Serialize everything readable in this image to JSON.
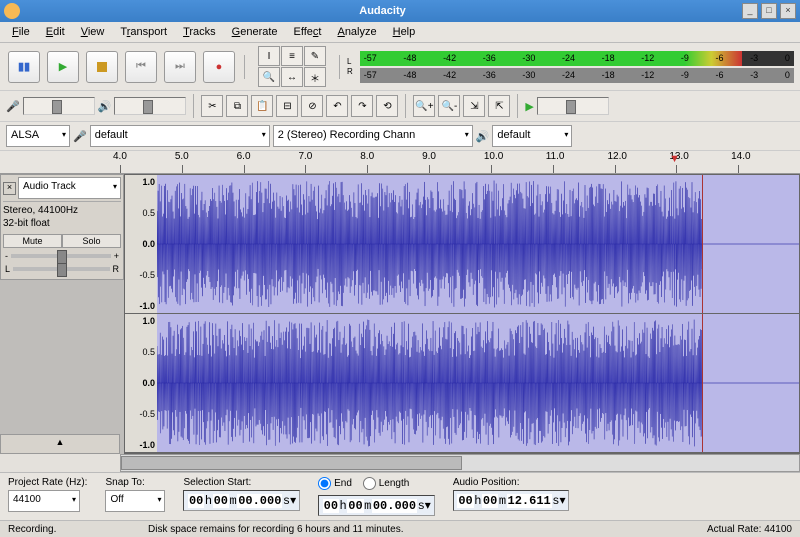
{
  "window": {
    "title": "Audacity"
  },
  "menu": {
    "items": [
      "File",
      "Edit",
      "View",
      "Transport",
      "Tracks",
      "Generate",
      "Effect",
      "Analyze",
      "Help"
    ]
  },
  "meters": {
    "ticks": [
      "-57",
      "-48",
      "-42",
      "-36",
      "-30",
      "-24",
      "-18",
      "-12",
      "-9",
      "-6",
      "-3",
      "0"
    ]
  },
  "device_row": {
    "host": "ALSA",
    "rec_dev": "default",
    "channels": "2 (Stereo) Recording Chann",
    "play_dev": "default"
  },
  "timeline": {
    "ticks": [
      "4.0",
      "5.0",
      "6.0",
      "7.0",
      "8.0",
      "9.0",
      "10.0",
      "11.0",
      "12.0",
      "13.0",
      "14.0"
    ]
  },
  "track": {
    "name": "Audio Track",
    "format_line1": "Stereo, 44100Hz",
    "format_line2": "32-bit float",
    "mute": "Mute",
    "solo": "Solo",
    "pan_l": "L",
    "pan_r": "R",
    "scale": [
      "1.0",
      "0.5",
      "0.0",
      "-0.5",
      "-1.0"
    ]
  },
  "bottom": {
    "rate_label": "Project Rate (Hz):",
    "rate": "44100",
    "snap_label": "Snap To:",
    "snap": "Off",
    "sel_start": "Selection Start:",
    "end": "End",
    "length": "Length",
    "audio_pos": "Audio Position:",
    "tc_zero_h": "00",
    "tc_zero_m": "00",
    "tc_zero_s": "00.000",
    "tc_unit": "s",
    "tc_pos_s": "12.611"
  },
  "status": {
    "left": "Recording.",
    "center": "Disk space remains for recording 6 hours and 11 minutes.",
    "right": "Actual Rate: 44100"
  }
}
